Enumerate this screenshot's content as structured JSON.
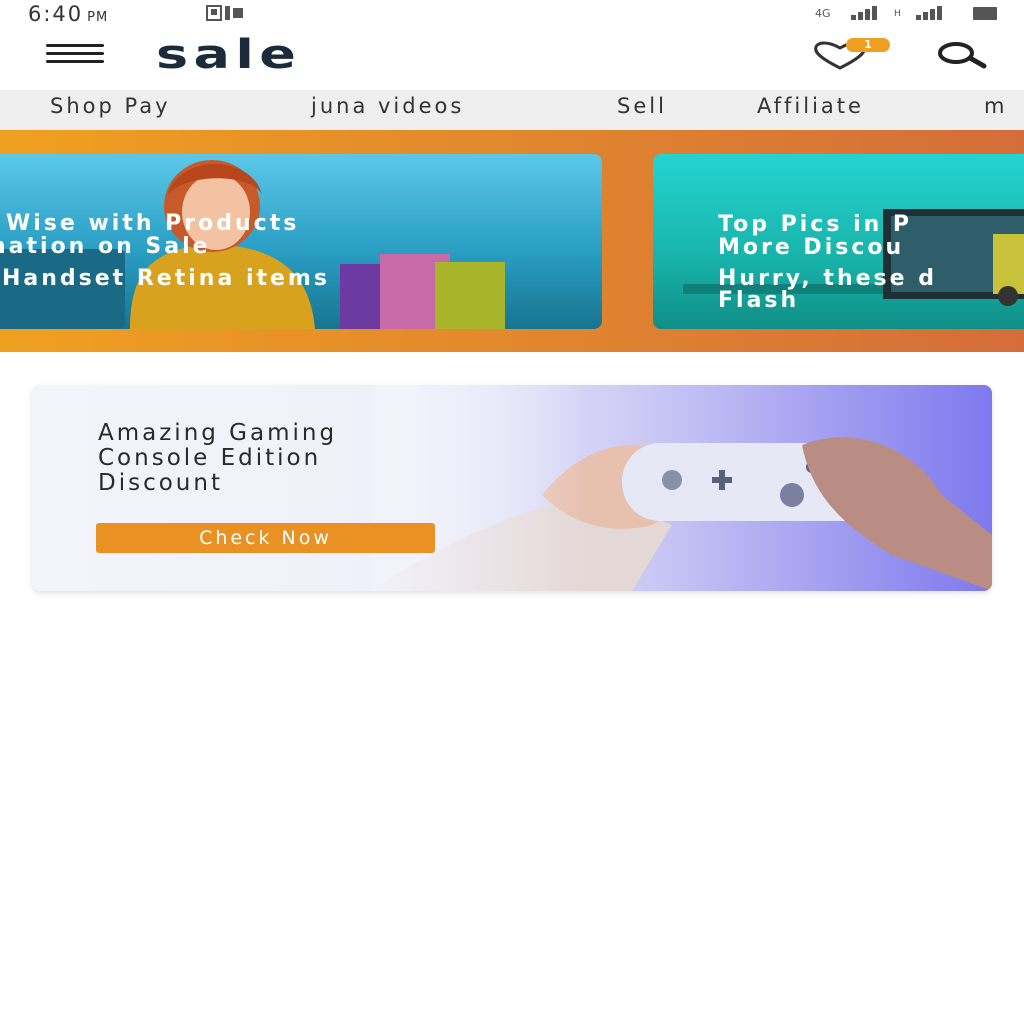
{
  "status_bar": {
    "time": "6:40",
    "ampm": "PM"
  },
  "header": {
    "brand": "sale",
    "wishlist_count": "1"
  },
  "nav": {
    "items": [
      {
        "label": "Shop Pay"
      },
      {
        "label": "juna videos"
      },
      {
        "label": "Sell"
      },
      {
        "label": "Affiliate"
      },
      {
        "label": "m"
      }
    ]
  },
  "promos": [
    {
      "lines": [
        "Wise with Products",
        "nation on Sale",
        "Handset Retina items"
      ]
    },
    {
      "lines": [
        "Top Pics in P",
        "More Discou",
        "Hurry, these d",
        "Flash"
      ]
    }
  ],
  "feature": {
    "title_lines": [
      "Amazing Gaming",
      "Console Edition",
      "Discount"
    ],
    "button": "Check Now"
  },
  "colors": {
    "accent": "#e99223",
    "badge": "#f0a020",
    "brand": "#1c2b3a",
    "nav_bg": "#efefef"
  },
  "icons": [
    "menu-icon",
    "heart-icon",
    "search-icon",
    "notification-icon",
    "signal-icon",
    "battery-icon"
  ]
}
